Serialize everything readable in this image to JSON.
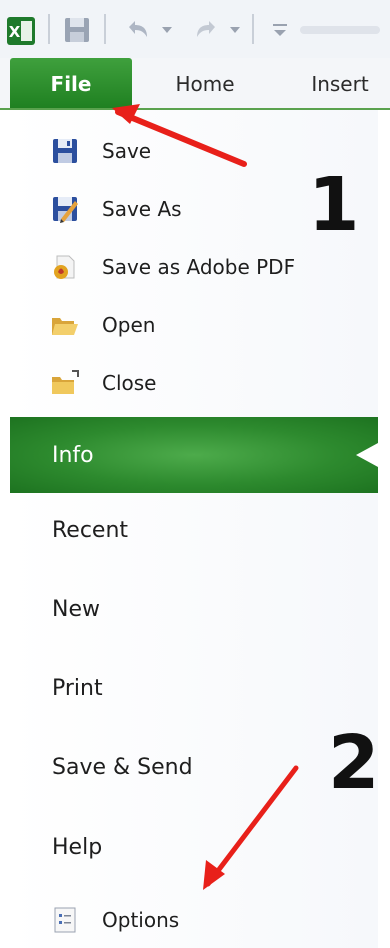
{
  "ribbon": {
    "tabs": {
      "file": "File",
      "home": "Home",
      "insert": "Insert"
    }
  },
  "backstage": {
    "commands": {
      "save": "Save",
      "save_as": "Save As",
      "save_pdf": "Save as Adobe PDF",
      "open": "Open",
      "close": "Close"
    },
    "selected": "Info",
    "sections": {
      "recent": "Recent",
      "new": "New",
      "print": "Print",
      "save_send": "Save & Send",
      "help": "Help"
    },
    "options": "Options"
  },
  "annotations": {
    "step1": "1",
    "step2": "2"
  },
  "colors": {
    "file_tab": "#2a8c2c",
    "info_highlight": "#2d8a2e",
    "arrow": "#e8201a"
  }
}
